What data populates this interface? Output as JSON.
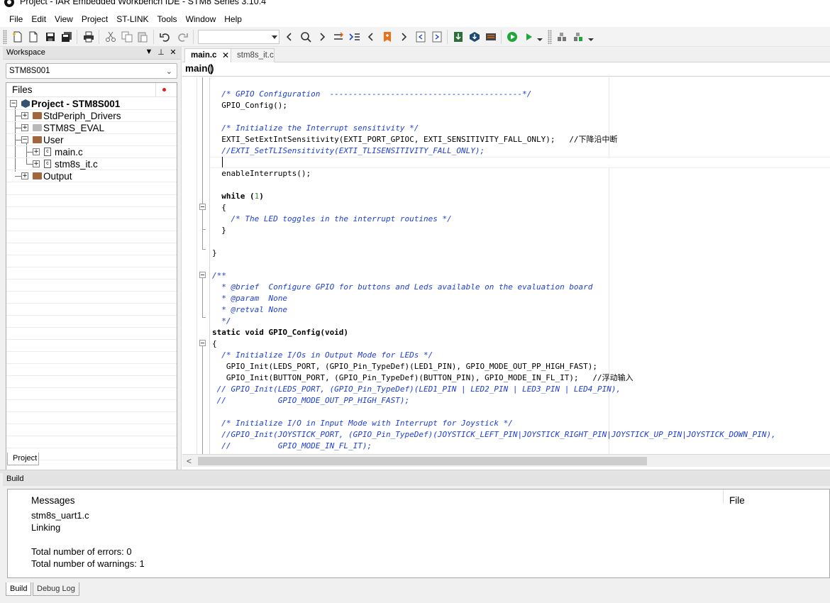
{
  "window": {
    "title": "Project - IAR Embedded Workbench IDE - STM8 Series 3.10.4"
  },
  "menu": [
    "File",
    "Edit",
    "View",
    "Project",
    "ST-LINK",
    "Tools",
    "Window",
    "Help"
  ],
  "toolbar": {
    "combo_value": "",
    "buttons": [
      "new-file",
      "new-document",
      "save",
      "save-all",
      "print",
      "cut",
      "copy",
      "paste",
      "undo",
      "redo",
      "find-prev",
      "find",
      "find-next",
      "go-to",
      "toggle-bookmark",
      "prev-bookmark",
      "next-bookmark",
      "navigate-back",
      "navigate-forward",
      "compile",
      "make",
      "debug",
      "download-debug",
      "stop",
      "breakpoint"
    ]
  },
  "workspace": {
    "title": "Workspace",
    "configuration": "STM8S001",
    "files_header": "Files",
    "tree": [
      {
        "label": "Project - STM8S001",
        "type": "project",
        "level": 0
      },
      {
        "label": "StdPeriph_Drivers",
        "type": "folder",
        "level": 1
      },
      {
        "label": "STM8S_EVAL",
        "type": "folder-gray",
        "level": 1
      },
      {
        "label": "User",
        "type": "folder",
        "level": 1
      },
      {
        "label": "main.c",
        "type": "file",
        "level": 2
      },
      {
        "label": "stm8s_it.c",
        "type": "file",
        "level": 2
      },
      {
        "label": "Output",
        "type": "folder",
        "level": 1
      }
    ],
    "bottom_tab": "Project"
  },
  "editor": {
    "tabs": [
      {
        "label": "main.c",
        "active": true,
        "close": "✕"
      },
      {
        "label": "stm8s_it.c",
        "active": false
      }
    ],
    "function": "main()",
    "code_lines": [
      "  /* GPIO Configuration  -----------------------------------------*/",
      "  GPIO_Config();",
      "",
      "  /* Initialize the Interrupt sensitivity */",
      "  EXTI_SetExtIntSensitivity(EXTI_PORT_GPIOC, EXTI_SENSITIVITY_FALL_ONLY);   //下降沿中断",
      "  //EXTI_SetTLISensitivity(EXTI_TLISENSITIVITY_FALL_ONLY);",
      "",
      "  enableInterrupts();",
      "",
      "  while (1)",
      "  {",
      "    /* The LED toggles in the interrupt routines */",
      "  }",
      "",
      "}",
      "",
      "/**",
      "  * @brief  Configure GPIO for buttons and Leds available on the evaluation board",
      "  * @param  None",
      "  * @retval None",
      "  */",
      "static void GPIO_Config(void)",
      "{",
      "  /* Initialize I/Os in Output Mode for LEDs */",
      "   GPIO_Init(LEDS_PORT, (GPIO_Pin_TypeDef)(LED1_PIN), GPIO_MODE_OUT_PP_HIGH_FAST);",
      "   GPIO_Init(BUTTON_PORT, (GPIO_Pin_TypeDef)(BUTTON_PIN), GPIO_MODE_IN_FL_IT);   //浮动输入",
      " // GPIO_Init(LEDS_PORT, (GPIO_Pin_TypeDef)(LED1_PIN | LED2_PIN | LED3_PIN | LED4_PIN),",
      " //           GPIO_MODE_OUT_PP_HIGH_FAST);",
      "",
      "  /* Initialize I/O in Input Mode with Interrupt for Joystick */",
      "  //GPIO_Init(JOYSTICK_PORT, (GPIO_Pin_TypeDef)(JOYSTICK_LEFT_PIN|JOYSTICK_RIGHT_PIN|JOYSTICK_UP_PIN|JOYSTICK_DOWN_PIN),",
      "  //          GPIO_MODE_IN_FL_IT);"
    ],
    "scroll_left": "<"
  },
  "build": {
    "title": "Build",
    "messages_header": "Messages",
    "file_header": "File",
    "messages": [
      "stm8s_uart1.c",
      "Linking",
      "",
      "Total number of errors: 0",
      "Total number of warnings: 1"
    ],
    "tabs": [
      "Build",
      "Debug Log"
    ]
  },
  "colors": {
    "comment": "#1f3fd1",
    "accent_green": "#1fa83a",
    "accent_orange": "#e8731a",
    "error_dot": "#e11d1d"
  }
}
